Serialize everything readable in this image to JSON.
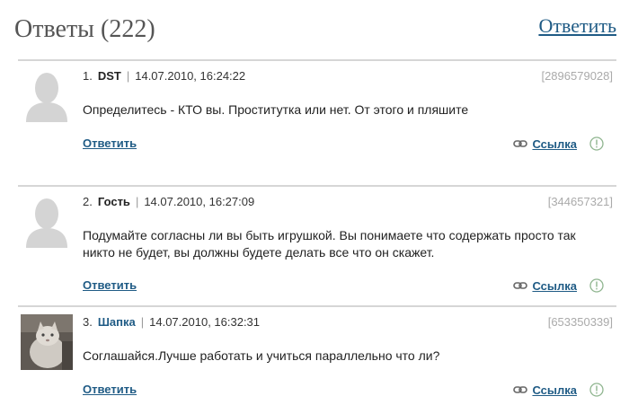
{
  "header": {
    "title": "Ответы (222)",
    "reply_label": "Ответить"
  },
  "answers": [
    {
      "number": "1.",
      "author": "DST",
      "date": "14.07.2010, 16:24:22",
      "id": "[2896579028]",
      "text": "Определитесь - КТО вы. Проститутка или нет. От этого и пляшите",
      "reply_label": "Ответить",
      "link_label": "Ссылка"
    },
    {
      "number": "2.",
      "author": "Гость",
      "date": "14.07.2010, 16:27:09",
      "id": "[344657321]",
      "text": "Подумайте согласны ли вы быть игрушкой. Вы понимаете что содержать просто так никто не будет, вы должны будете делать все что он скажет.",
      "reply_label": "Ответить",
      "link_label": "Ссылка"
    },
    {
      "number": "3.",
      "author": "Шапка",
      "date": "14.07.2010, 16:32:31",
      "id": "[653350339]",
      "text": "Соглашайся.Лучше работать и учиться параллельно что ли?",
      "reply_label": "Ответить",
      "link_label": "Ссылка"
    }
  ],
  "colors": {
    "link": "#1f5b85",
    "title": "#555555",
    "separator": "#d6d6d6",
    "muted": "#aaaaaa"
  },
  "icons": [
    "default-avatar-icon",
    "chain-link-icon",
    "report-icon"
  ]
}
